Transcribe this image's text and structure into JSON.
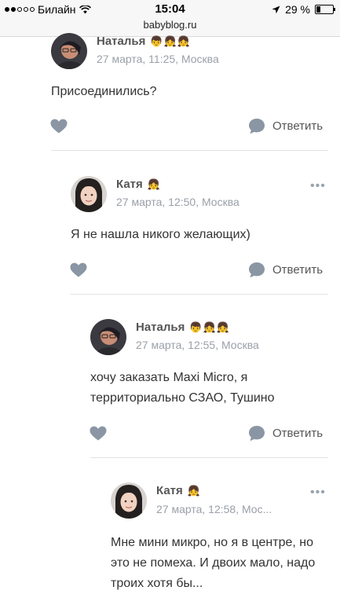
{
  "status_bar": {
    "carrier": "Билайн",
    "time": "15:04",
    "url": "babyblog.ru",
    "battery_percent": "29 %",
    "battery_level": 0.29,
    "signal_bars_filled": 2
  },
  "actions": {
    "reply_label": "Ответить"
  },
  "comments": [
    {
      "author": "Наталья",
      "badges": "👦👧👧",
      "date": "27 марта, 11:25, Москва",
      "text": "Присоединились?"
    },
    {
      "author": "Катя",
      "badges": "👧",
      "date": "27 марта, 12:50, Москва",
      "text": "Я не нашла никого желающих)",
      "more": "•••"
    },
    {
      "author": "Наталья",
      "badges": "👦👧👧",
      "date": "27 марта, 12:55, Москва",
      "text": "хочу заказать Maxi Micro, я территориально СЗАО, Тушино"
    },
    {
      "author": "Катя",
      "badges": "👧",
      "date": "27 марта, 12:58, Мос...",
      "text": "Мне мини микро, но я в центре, но это не помеха. И двоих мало, надо троих хотя бы...",
      "more": "•••"
    }
  ],
  "colors": {
    "icon_gray": "#8a96a3",
    "meta_gray": "#9aa0a8",
    "divider": "#e2e2e2"
  }
}
